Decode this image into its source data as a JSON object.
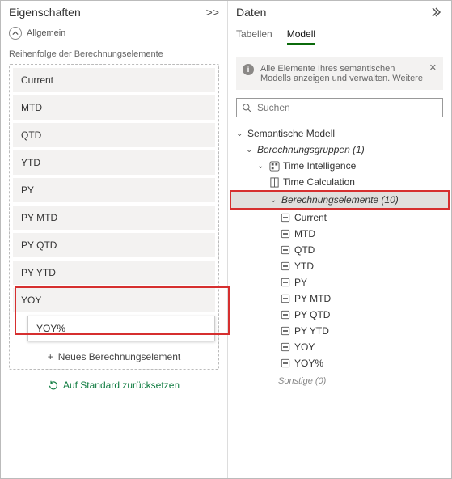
{
  "left": {
    "title": "Eigenschaften",
    "collapse": ">>",
    "section": "Allgemein",
    "listHeader": "Reihenfolge der Berechnungselemente",
    "items": [
      "Current",
      "MTD",
      "QTD",
      "YTD",
      "PY",
      "PY MTD",
      "PY QTD",
      "PY YTD",
      "YOY"
    ],
    "draggedItem": "YOY%",
    "addLabel": "Neues Berechnungselement",
    "resetLabel": "Auf Standard zurücksetzen"
  },
  "right": {
    "title": "Daten",
    "tabs": {
      "tabellen": "Tabellen",
      "modell": "Modell"
    },
    "banner": {
      "line1": "Alle Elemente Ihres semantischen",
      "line2": "Modells anzeigen und verwalten. Weitere"
    },
    "searchPlaceholder": "Suchen",
    "tree": {
      "root": "Semantische Modell",
      "groups": "Berechnungsgruppen (1)",
      "timeIntel": "Time Intelligence",
      "timeCalc": "Time Calculation",
      "calcItems": "Berechnungselemente (10)",
      "items": [
        "Current",
        "MTD",
        "QTD",
        "YTD",
        "PY",
        "PY MTD",
        "PY QTD",
        "PY YTD",
        "YOY",
        "YOY%"
      ],
      "other": "Sonstige (0)"
    }
  }
}
